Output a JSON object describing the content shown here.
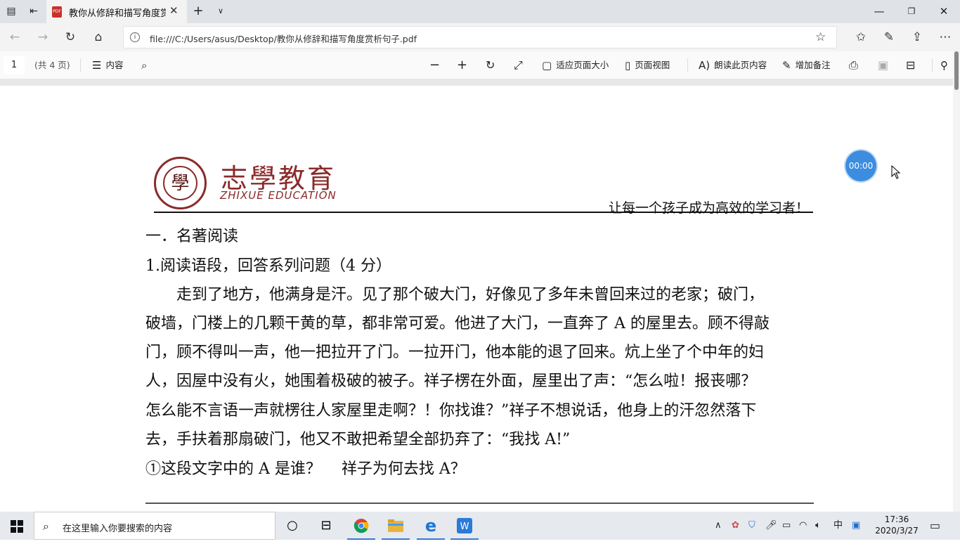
{
  "browser": {
    "tab_title": "教你从修辞和描写角度赏析句子.pdf",
    "url": "file:///C:/Users/asus/Desktop/教你从修辞和描写角度赏析句子.pdf"
  },
  "pdf_toolbar": {
    "page_number": "1",
    "page_total": "(共 4 页)",
    "contents_label": "内容",
    "fit_page_label": "适应页面大小",
    "page_view_label": "页面视图",
    "read_aloud_label": "朗读此页内容",
    "add_notes_label": "增加备注"
  },
  "document": {
    "brand_cn": "志學教育",
    "brand_en": "ZHIXUE EDUCATION",
    "seal_char": "學",
    "slogan": "让每一个孩子成为高效的学习者！",
    "lines": [
      "一．名著阅读",
      "1.阅读语段，回答系列问题（4 分）",
      "　　走到了地方，他满身是汗。见了那个破大门，好像见了多年未曾回来过的老家；破门，",
      "破墙，门楼上的几颗干黄的草，都非常可爱。他进了大门，一直奔了 A 的屋里去。顾不得敲",
      "门，顾不得叫一声，他一把拉开了门。一拉开门，他本能的退了回来。炕上坐了个中年的妇",
      "人，因屋中没有火，她围着极破的被子。祥子楞在外面，屋里出了声：“怎么啦！报丧哪？",
      "怎么能不言语一声就楞往人家屋里走啊？！你找谁？”祥子不想说话，他身上的汗忽然落下",
      "去，手扶着那扇破门，他又不敢把希望全部扔弃了：“我找 A!”",
      "①这段文字中的 A 是谁？　 祥子为何去找 A？"
    ]
  },
  "timer": "00:00",
  "taskbar": {
    "search_placeholder": "在这里输入你要搜索的内容",
    "time": "17:36",
    "date": "2020/3/27",
    "ime": "中"
  }
}
